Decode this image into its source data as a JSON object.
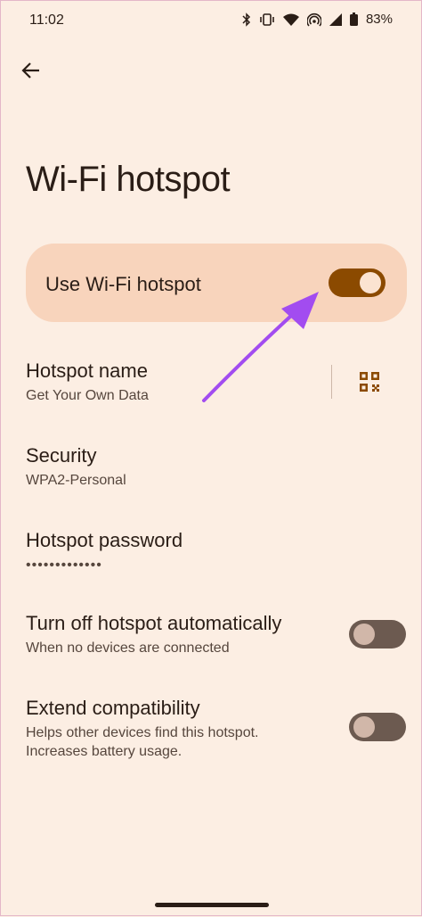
{
  "status_bar": {
    "time": "11:02",
    "battery_percent": "83%",
    "icons": [
      "bluetooth-icon",
      "vibrate-icon",
      "wifi-icon",
      "hotspot-icon",
      "cell-signal-icon",
      "battery-icon"
    ]
  },
  "header": {
    "back_icon": "arrow-back-icon",
    "title": "Wi-Fi hotspot"
  },
  "main_toggle": {
    "label": "Use Wi-Fi hotspot",
    "checked": true
  },
  "settings": {
    "hotspot_name": {
      "title": "Hotspot name",
      "value": "Get Your Own Data",
      "action_icon": "qr-code-icon"
    },
    "security": {
      "title": "Security",
      "value": "WPA2-Personal"
    },
    "password": {
      "title": "Hotspot password",
      "value": "•••••••••••••"
    },
    "auto_off": {
      "title": "Turn off hotspot automatically",
      "subtitle": "When no devices are connected",
      "checked": false
    },
    "extend": {
      "title": "Extend compatibility",
      "subtitle_line1": "Helps other devices find this hotspot.",
      "subtitle_line2": "Increases battery usage.",
      "checked": false
    }
  },
  "colors": {
    "background": "#fceee3",
    "card": "#f8d4bc",
    "switch_on": "#8b4a00",
    "switch_off": "#6c5a50",
    "annotation_arrow": "#a24cf0"
  }
}
